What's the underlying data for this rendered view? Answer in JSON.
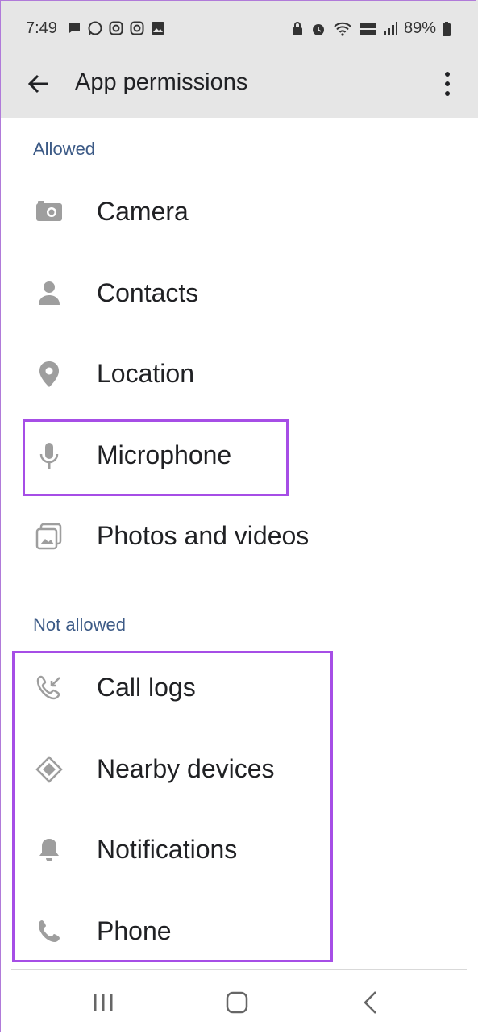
{
  "status_bar": {
    "time": "7:49",
    "battery": "89%"
  },
  "app_bar": {
    "title": "App permissions"
  },
  "sections": {
    "allowed": {
      "header": "Allowed",
      "items": [
        {
          "label": "Camera",
          "icon": "camera-icon"
        },
        {
          "label": "Contacts",
          "icon": "person-icon"
        },
        {
          "label": "Location",
          "icon": "location-pin-icon"
        },
        {
          "label": "Microphone",
          "icon": "microphone-icon"
        },
        {
          "label": "Photos and videos",
          "icon": "photos-icon"
        }
      ]
    },
    "not_allowed": {
      "header": "Not allowed",
      "items": [
        {
          "label": "Call logs",
          "icon": "call-log-icon"
        },
        {
          "label": "Nearby devices",
          "icon": "nearby-devices-icon"
        },
        {
          "label": "Notifications",
          "icon": "bell-icon"
        },
        {
          "label": "Phone",
          "icon": "phone-icon"
        }
      ]
    }
  },
  "colors": {
    "section_header": "#3c5a86",
    "highlight": "#a64ee6",
    "icon": "#9e9e9e",
    "bar_background": "#e6e6e6"
  }
}
